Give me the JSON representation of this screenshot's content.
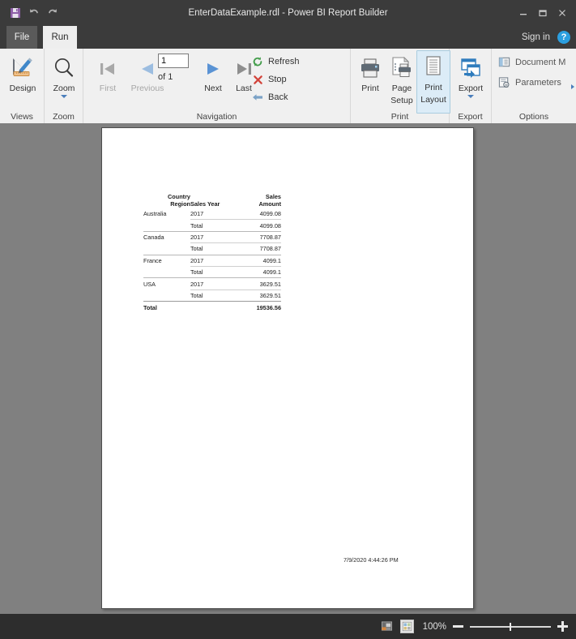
{
  "window": {
    "title": "EnterDataExample.rdl - Power BI Report Builder",
    "quick_access": {
      "save": "save-icon",
      "undo": "undo-icon",
      "redo": "redo-icon"
    },
    "controls": {
      "minimize": "minimize",
      "restore": "restore",
      "close": "close"
    }
  },
  "tabs": {
    "file": "File",
    "run": "Run",
    "signin": "Sign in",
    "help": "?"
  },
  "ribbon": {
    "groups": {
      "views": "Views",
      "zoom": "Zoom",
      "navigation": "Navigation",
      "print": "Print",
      "export": "Export",
      "options": "Options"
    },
    "design": "Design",
    "zoom_btn": "Zoom",
    "first": "First",
    "previous": "Previous",
    "next": "Next",
    "last": "Last",
    "page_value": "1",
    "page_of": "of  1",
    "refresh": "Refresh",
    "stop": "Stop",
    "back": "Back",
    "print": "Print",
    "page_setup_1": "Page",
    "page_setup_2": "Setup",
    "print_layout_1": "Print",
    "print_layout_2": "Layout",
    "export": "Export",
    "document_map": "Document M",
    "parameters": "Parameters"
  },
  "report": {
    "headers": {
      "col1_line1": "Country",
      "col1_line2": "Region",
      "col2": "Sales Year",
      "col3_line1": "Sales",
      "col3_line2": "Amount"
    },
    "rows": [
      {
        "country": "Australia",
        "year": "2017",
        "amount": "4099.08"
      },
      {
        "country": "",
        "year": "Total",
        "amount": "4099.08"
      },
      {
        "country": "Canada",
        "year": "2017",
        "amount": "7708.87"
      },
      {
        "country": "",
        "year": "Total",
        "amount": "7708.87"
      },
      {
        "country": "France",
        "year": "2017",
        "amount": "4099.1"
      },
      {
        "country": "",
        "year": "Total",
        "amount": "4099.1"
      },
      {
        "country": "USA",
        "year": "2017",
        "amount": "3629.51"
      },
      {
        "country": "",
        "year": "Total",
        "amount": "3629.51"
      }
    ],
    "grand_total": {
      "label": "Total",
      "year": "",
      "amount": "19536.56"
    },
    "timestamp": "7/9/2020 4:44:26 PM"
  },
  "statusbar": {
    "zoom_level": "100%",
    "minus": "-",
    "plus": "+"
  },
  "colors": {
    "titlebar": "#3b3b3b",
    "ribbon": "#f0f0f0",
    "canvas": "#808080",
    "accent_blue": "#4a7ebb",
    "save_purple": "#8e5ea8",
    "refresh_green": "#3f9b47",
    "stop_red": "#d2433a",
    "help_blue": "#2b9fe0"
  }
}
